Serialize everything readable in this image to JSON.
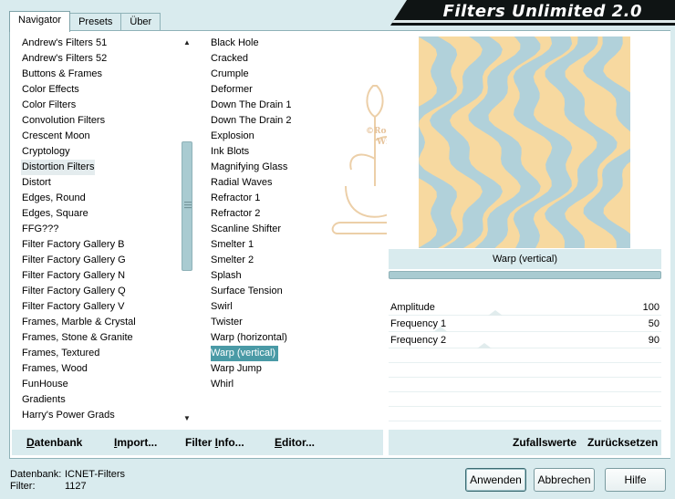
{
  "window": {
    "title": "Filters Unlimited 2.0"
  },
  "tabs": [
    {
      "label": "Navigator",
      "active": true
    },
    {
      "label": "Presets",
      "active": false
    },
    {
      "label": "Über",
      "active": false
    }
  ],
  "categories": [
    "Andrew's Filters 51",
    "Andrew's Filters 52",
    "Buttons & Frames",
    "Color Effects",
    "Color Filters",
    "Convolution Filters",
    "Crescent Moon",
    "Cryptology",
    "Distortion Filters",
    "Distort",
    "Edges, Round",
    "Edges, Square",
    "FFG???",
    "Filter Factory Gallery B",
    "Filter Factory Gallery G",
    "Filter Factory Gallery N",
    "Filter Factory Gallery Q",
    "Filter Factory Gallery V",
    "Frames, Marble & Crystal",
    "Frames, Stone & Granite",
    "Frames, Textured",
    "Frames, Wood",
    "FunHouse",
    "Gradients",
    "Harry's Power Grads"
  ],
  "selected_category": "Distortion Filters",
  "filters": [
    "Black Hole",
    "Cracked",
    "Crumple",
    "Deformer",
    "Down The Drain 1",
    "Down The Drain 2",
    "Explosion",
    "Ink Blots",
    "Magnifying Glass",
    "Radial Waves",
    "Refractor 1",
    "Refractor 2",
    "Scanline Shifter",
    "Smelter 1",
    "Smelter 2",
    "Splash",
    "Surface Tension",
    "Swirl",
    "Twister",
    "Warp (horizontal)",
    "Warp (vertical)",
    "Warp Jump",
    "Whirl"
  ],
  "selected_filter": "Warp (vertical)",
  "watermark": {
    "text_line1": "©Rosengarten",
    "text_line2": "Wien"
  },
  "preview": {
    "filter_name": "Warp (vertical)",
    "colors": {
      "light": "#f7d9a0",
      "blue": "#a9cfe0"
    }
  },
  "params": [
    {
      "label": "Amplitude",
      "value": "100",
      "level": 0.39
    },
    {
      "label": "Frequency 1",
      "value": "50",
      "level": 0.19
    },
    {
      "label": "Frequency 2",
      "value": "90",
      "level": 0.35
    }
  ],
  "actions_left": [
    {
      "label_under": "D",
      "label_rest": "atenbank"
    },
    {
      "label_under": "I",
      "label_rest": "mport..."
    },
    {
      "label_pre": "Filter ",
      "label_under": "I",
      "label_rest": "nfo..."
    },
    {
      "label_under": "E",
      "label_rest": "ditor..."
    }
  ],
  "actions_right": [
    {
      "label": "Zufallswerte"
    },
    {
      "label": "Zurücksetzen"
    }
  ],
  "status": {
    "db_label": "Datenbank:",
    "db_value": "ICNET-Filters",
    "filter_label": "Filter:",
    "filter_value": "1127"
  },
  "buttons": {
    "apply": "Anwenden",
    "cancel": "Abbrechen",
    "help": "Hilfe"
  }
}
